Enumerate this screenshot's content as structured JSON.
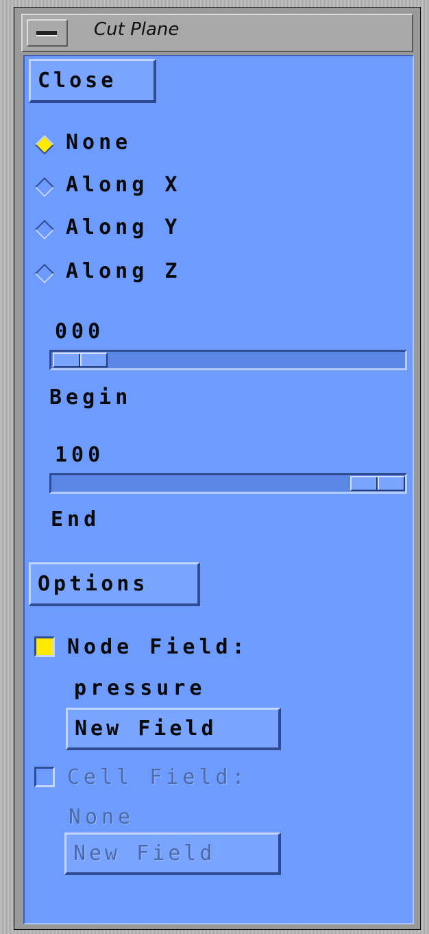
{
  "window": {
    "title": "Cut Plane"
  },
  "close_button": {
    "label": "Close"
  },
  "plane_options": [
    {
      "label": "None",
      "selected": true
    },
    {
      "label": "Along X",
      "selected": false
    },
    {
      "label": "Along Y",
      "selected": false
    },
    {
      "label": "Along Z",
      "selected": false
    }
  ],
  "begin_slider": {
    "value": "000",
    "label": "Begin",
    "fraction": 0.0
  },
  "end_slider": {
    "value": "100",
    "label": "End",
    "fraction": 1.0
  },
  "options_button": {
    "label": "Options"
  },
  "node_field": {
    "label": "Node Field:",
    "value": "pressure",
    "checked": true,
    "button_label": "New Field"
  },
  "cell_field": {
    "label": "Cell Field:",
    "value": "None",
    "checked": false,
    "button_label": "New Field"
  },
  "colors": {
    "panel": "#6e9bfe",
    "selected_indicator": "#ffea00",
    "title_bar": "#a9a9a9"
  }
}
